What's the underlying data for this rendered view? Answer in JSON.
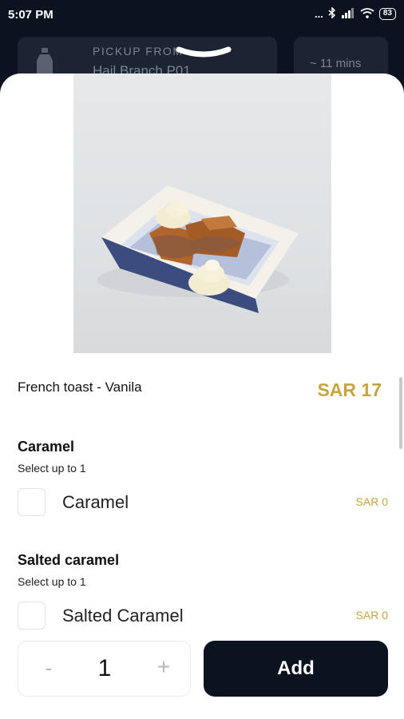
{
  "status_bar": {
    "time": "5:07 PM",
    "signal_text": "...",
    "battery": "83"
  },
  "header": {
    "pickup_label": "PICKUP FROM",
    "branch": "Hail Branch P01",
    "eta": "~ 11 mins"
  },
  "item": {
    "name": "French toast - Vanila",
    "price": "SAR 17"
  },
  "option_groups": [
    {
      "title": "Caramel",
      "subtitle": "Select up to 1",
      "options": [
        {
          "label": "Caramel",
          "price": "SAR 0",
          "checked": false
        }
      ]
    },
    {
      "title": "Salted caramel",
      "subtitle": "Select up to 1",
      "options": [
        {
          "label": "Salted Caramel",
          "price": "SAR 0",
          "checked": false
        }
      ]
    }
  ],
  "quantity": {
    "minus": "-",
    "value": "1",
    "plus": "+"
  },
  "add_button_label": "Add",
  "colors": {
    "accent": "#c8a440",
    "dark": "#0b1220"
  }
}
